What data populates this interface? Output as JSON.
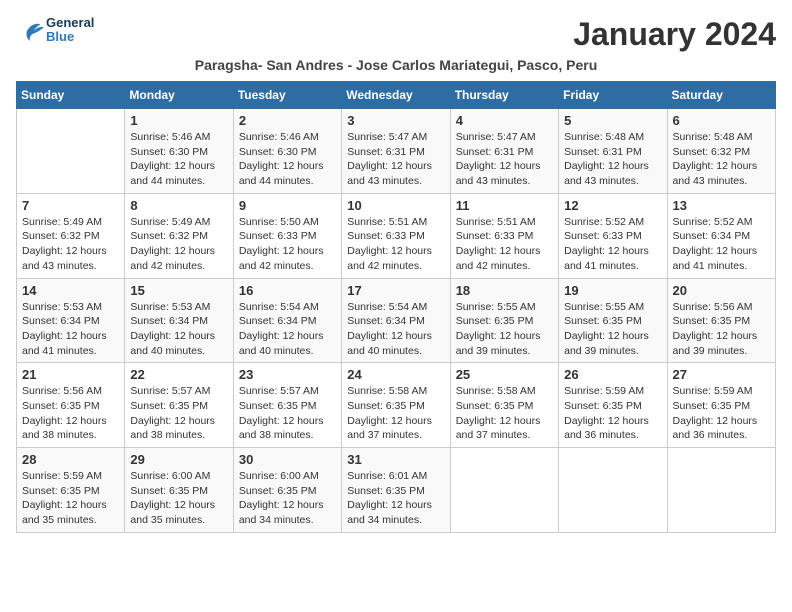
{
  "header": {
    "logo_general": "General",
    "logo_blue": "Blue",
    "month_title": "January 2024",
    "subtitle": "Paragsha- San Andres - Jose Carlos Mariategui, Pasco, Peru"
  },
  "days_of_week": [
    "Sunday",
    "Monday",
    "Tuesday",
    "Wednesday",
    "Thursday",
    "Friday",
    "Saturday"
  ],
  "weeks": [
    [
      {
        "day": "",
        "sunrise": "",
        "sunset": "",
        "daylight": ""
      },
      {
        "day": "1",
        "sunrise": "5:46 AM",
        "sunset": "6:30 PM",
        "daylight": "12 hours and 44 minutes."
      },
      {
        "day": "2",
        "sunrise": "5:46 AM",
        "sunset": "6:30 PM",
        "daylight": "12 hours and 44 minutes."
      },
      {
        "day": "3",
        "sunrise": "5:47 AM",
        "sunset": "6:31 PM",
        "daylight": "12 hours and 43 minutes."
      },
      {
        "day": "4",
        "sunrise": "5:47 AM",
        "sunset": "6:31 PM",
        "daylight": "12 hours and 43 minutes."
      },
      {
        "day": "5",
        "sunrise": "5:48 AM",
        "sunset": "6:31 PM",
        "daylight": "12 hours and 43 minutes."
      },
      {
        "day": "6",
        "sunrise": "5:48 AM",
        "sunset": "6:32 PM",
        "daylight": "12 hours and 43 minutes."
      }
    ],
    [
      {
        "day": "7",
        "sunrise": "5:49 AM",
        "sunset": "6:32 PM",
        "daylight": "12 hours and 43 minutes."
      },
      {
        "day": "8",
        "sunrise": "5:49 AM",
        "sunset": "6:32 PM",
        "daylight": "12 hours and 42 minutes."
      },
      {
        "day": "9",
        "sunrise": "5:50 AM",
        "sunset": "6:33 PM",
        "daylight": "12 hours and 42 minutes."
      },
      {
        "day": "10",
        "sunrise": "5:51 AM",
        "sunset": "6:33 PM",
        "daylight": "12 hours and 42 minutes."
      },
      {
        "day": "11",
        "sunrise": "5:51 AM",
        "sunset": "6:33 PM",
        "daylight": "12 hours and 42 minutes."
      },
      {
        "day": "12",
        "sunrise": "5:52 AM",
        "sunset": "6:33 PM",
        "daylight": "12 hours and 41 minutes."
      },
      {
        "day": "13",
        "sunrise": "5:52 AM",
        "sunset": "6:34 PM",
        "daylight": "12 hours and 41 minutes."
      }
    ],
    [
      {
        "day": "14",
        "sunrise": "5:53 AM",
        "sunset": "6:34 PM",
        "daylight": "12 hours and 41 minutes."
      },
      {
        "day": "15",
        "sunrise": "5:53 AM",
        "sunset": "6:34 PM",
        "daylight": "12 hours and 40 minutes."
      },
      {
        "day": "16",
        "sunrise": "5:54 AM",
        "sunset": "6:34 PM",
        "daylight": "12 hours and 40 minutes."
      },
      {
        "day": "17",
        "sunrise": "5:54 AM",
        "sunset": "6:34 PM",
        "daylight": "12 hours and 40 minutes."
      },
      {
        "day": "18",
        "sunrise": "5:55 AM",
        "sunset": "6:35 PM",
        "daylight": "12 hours and 39 minutes."
      },
      {
        "day": "19",
        "sunrise": "5:55 AM",
        "sunset": "6:35 PM",
        "daylight": "12 hours and 39 minutes."
      },
      {
        "day": "20",
        "sunrise": "5:56 AM",
        "sunset": "6:35 PM",
        "daylight": "12 hours and 39 minutes."
      }
    ],
    [
      {
        "day": "21",
        "sunrise": "5:56 AM",
        "sunset": "6:35 PM",
        "daylight": "12 hours and 38 minutes."
      },
      {
        "day": "22",
        "sunrise": "5:57 AM",
        "sunset": "6:35 PM",
        "daylight": "12 hours and 38 minutes."
      },
      {
        "day": "23",
        "sunrise": "5:57 AM",
        "sunset": "6:35 PM",
        "daylight": "12 hours and 38 minutes."
      },
      {
        "day": "24",
        "sunrise": "5:58 AM",
        "sunset": "6:35 PM",
        "daylight": "12 hours and 37 minutes."
      },
      {
        "day": "25",
        "sunrise": "5:58 AM",
        "sunset": "6:35 PM",
        "daylight": "12 hours and 37 minutes."
      },
      {
        "day": "26",
        "sunrise": "5:59 AM",
        "sunset": "6:35 PM",
        "daylight": "12 hours and 36 minutes."
      },
      {
        "day": "27",
        "sunrise": "5:59 AM",
        "sunset": "6:35 PM",
        "daylight": "12 hours and 36 minutes."
      }
    ],
    [
      {
        "day": "28",
        "sunrise": "5:59 AM",
        "sunset": "6:35 PM",
        "daylight": "12 hours and 35 minutes."
      },
      {
        "day": "29",
        "sunrise": "6:00 AM",
        "sunset": "6:35 PM",
        "daylight": "12 hours and 35 minutes."
      },
      {
        "day": "30",
        "sunrise": "6:00 AM",
        "sunset": "6:35 PM",
        "daylight": "12 hours and 34 minutes."
      },
      {
        "day": "31",
        "sunrise": "6:01 AM",
        "sunset": "6:35 PM",
        "daylight": "12 hours and 34 minutes."
      },
      {
        "day": "",
        "sunrise": "",
        "sunset": "",
        "daylight": ""
      },
      {
        "day": "",
        "sunrise": "",
        "sunset": "",
        "daylight": ""
      },
      {
        "day": "",
        "sunrise": "",
        "sunset": "",
        "daylight": ""
      }
    ]
  ]
}
